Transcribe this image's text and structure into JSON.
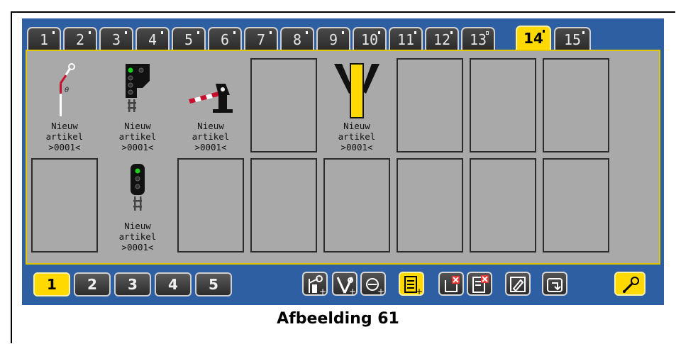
{
  "tabs": [
    {
      "label": "1",
      "marker": "dot"
    },
    {
      "label": "2",
      "marker": "dot"
    },
    {
      "label": "3",
      "marker": "dot"
    },
    {
      "label": "4",
      "marker": "dot"
    },
    {
      "label": "5",
      "marker": "dot"
    },
    {
      "label": "6",
      "marker": "dot"
    },
    {
      "label": "7",
      "marker": "dot"
    },
    {
      "label": "8",
      "marker": "dot"
    },
    {
      "label": "9",
      "marker": "dot"
    },
    {
      "label": "10",
      "marker": "dot"
    },
    {
      "label": "11",
      "marker": "dot"
    },
    {
      "label": "12",
      "marker": "dot"
    },
    {
      "label": "13",
      "marker": "hollow"
    },
    {
      "label": "14",
      "marker": "dot",
      "active": true
    },
    {
      "label": "15",
      "marker": "dot"
    }
  ],
  "grid": {
    "row1": [
      {
        "icon": "semaphore-signal-icon",
        "label": [
          "Nieuw",
          "artikel",
          ">0001<"
        ]
      },
      {
        "icon": "light-signal-icon",
        "label": [
          "Nieuw",
          "artikel",
          ">0001<"
        ]
      },
      {
        "icon": "barrier-icon",
        "label": [
          "Nieuw",
          "artikel",
          ">0001<"
        ]
      },
      {
        "icon": "",
        "label": []
      },
      {
        "icon": "switch-icon",
        "label": [
          "Nieuw",
          "artikel",
          ">0001<"
        ]
      },
      {
        "icon": "",
        "label": []
      },
      {
        "icon": "",
        "label": []
      },
      {
        "icon": "",
        "label": []
      }
    ],
    "row2": [
      {
        "icon": "",
        "label": []
      },
      {
        "icon": "dwarf-signal-icon",
        "label": [
          "Nieuw",
          "artikel",
          ">0001<"
        ]
      },
      {
        "icon": "",
        "label": []
      },
      {
        "icon": "",
        "label": []
      },
      {
        "icon": "",
        "label": []
      },
      {
        "icon": "",
        "label": []
      },
      {
        "icon": "",
        "label": []
      },
      {
        "icon": "",
        "label": []
      }
    ]
  },
  "pages": [
    {
      "label": "1",
      "active": true
    },
    {
      "label": "2"
    },
    {
      "label": "3"
    },
    {
      "label": "4"
    },
    {
      "label": "5"
    }
  ],
  "tools": [
    {
      "name": "add-semaphore-icon"
    },
    {
      "name": "add-switch-icon"
    },
    {
      "name": "add-signal-icon"
    },
    {
      "name": "add-list-icon",
      "yellow": true
    },
    {
      "name": "delete-item-icon"
    },
    {
      "name": "delete-list-icon"
    },
    {
      "name": "edit-icon"
    },
    {
      "name": "move-icon"
    },
    {
      "name": "settings-wrench-icon",
      "yellow": true
    }
  ],
  "caption": "Afbeelding 61"
}
